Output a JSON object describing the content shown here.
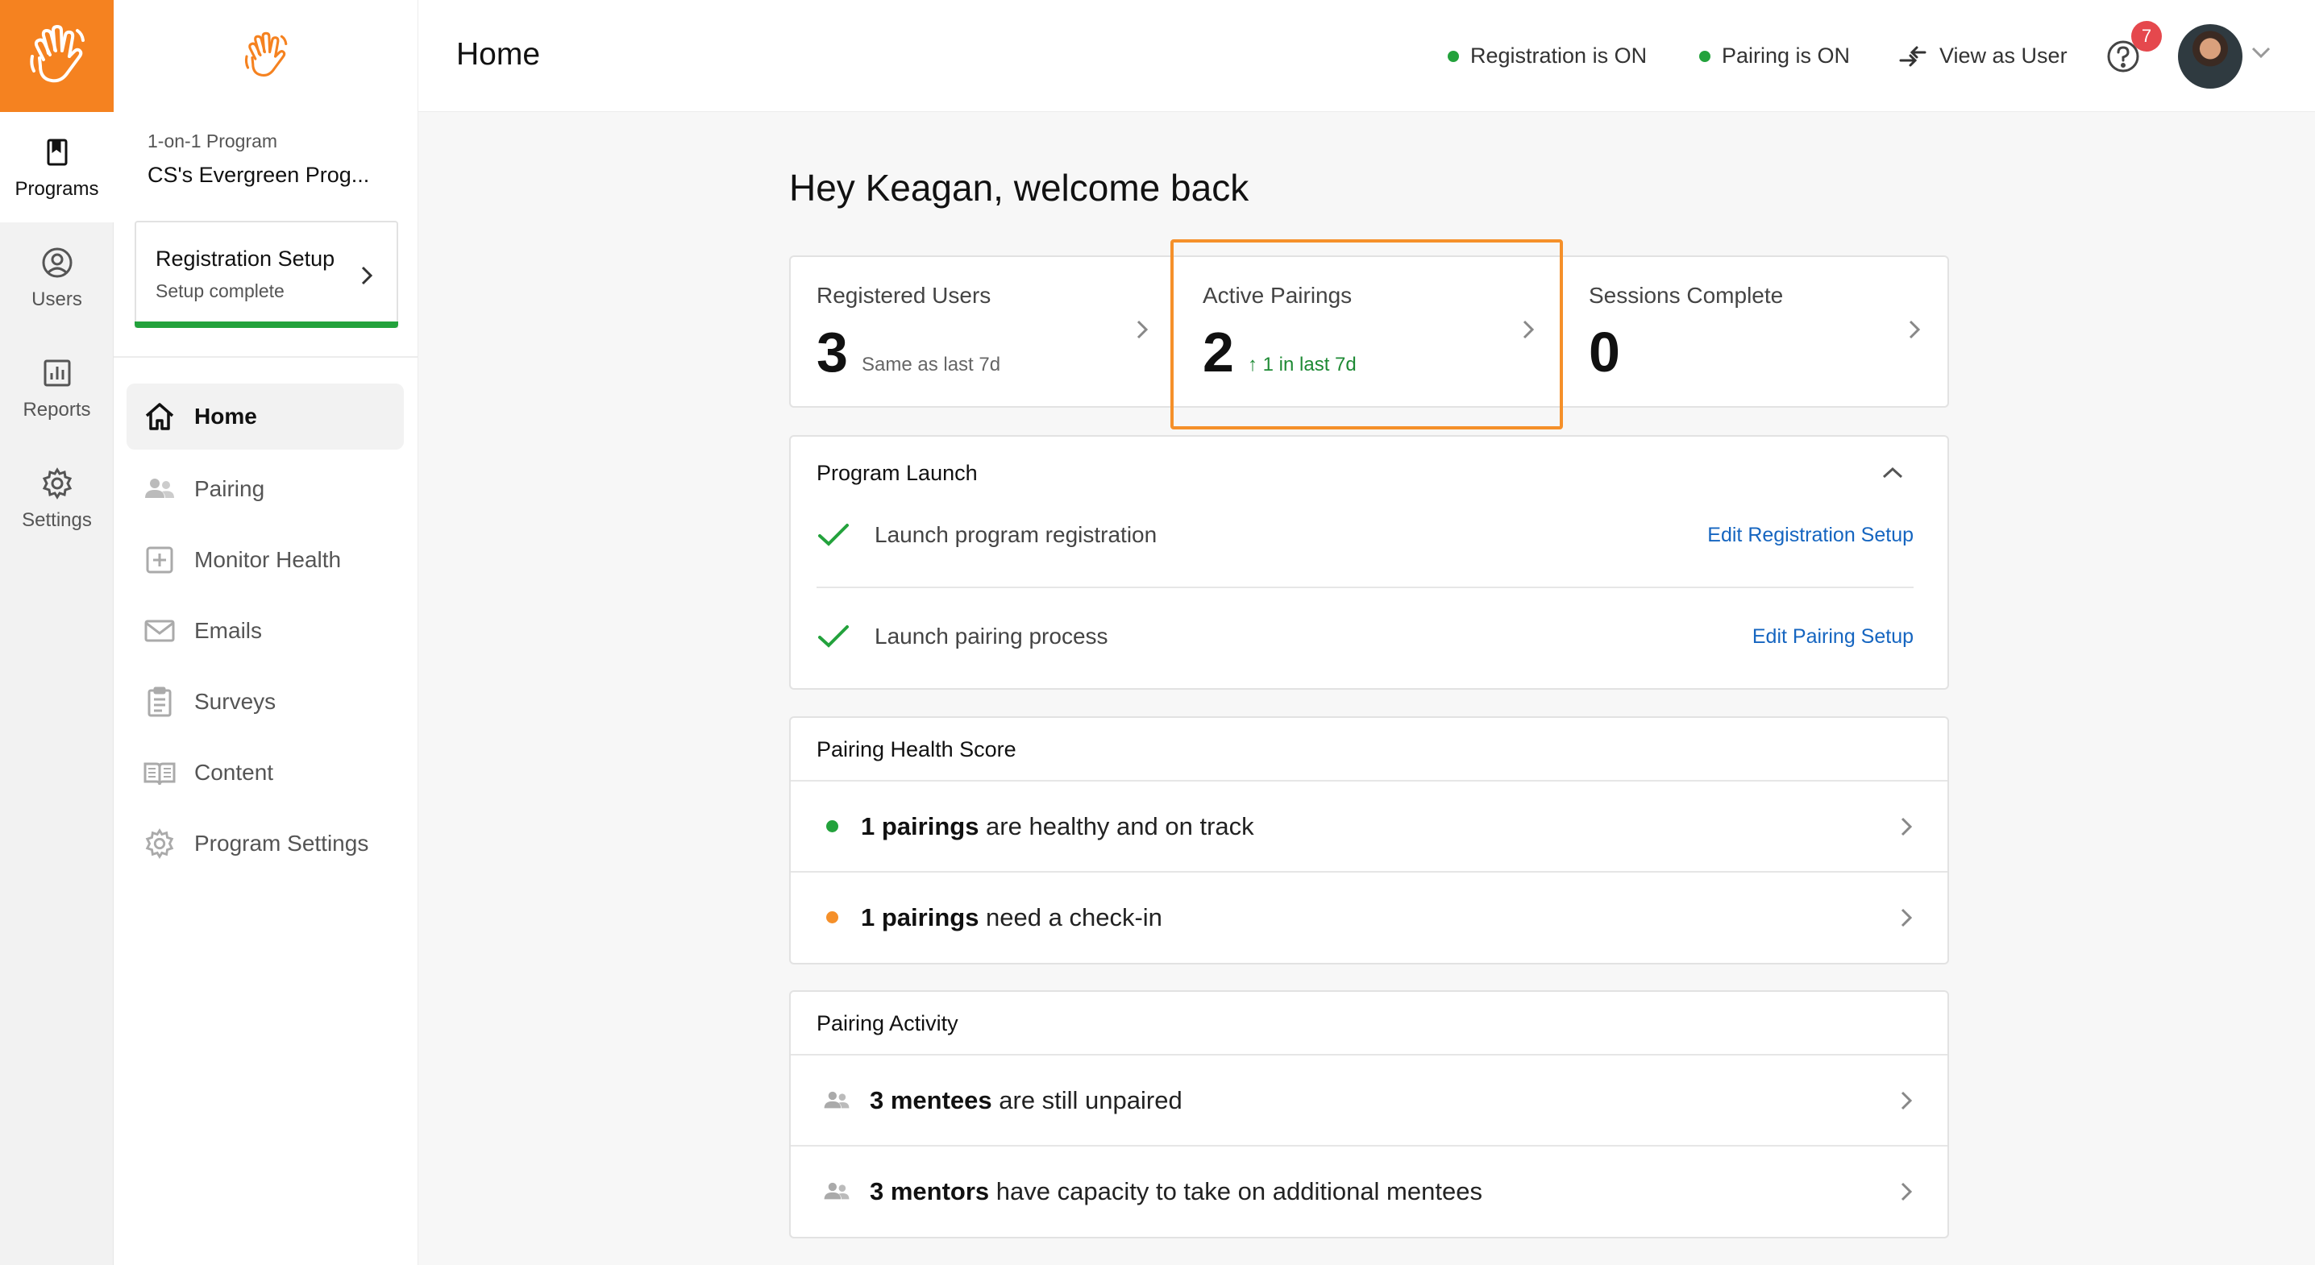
{
  "colors": {
    "brand": "#f58220",
    "green": "#23a23c",
    "orange": "#f5902a",
    "link": "#1565c0",
    "badge": "#e5484d"
  },
  "rail": {
    "items": [
      {
        "label": "Programs",
        "icon": "bookmark-icon",
        "active": true
      },
      {
        "label": "Users",
        "icon": "user-circle-icon"
      },
      {
        "label": "Reports",
        "icon": "bar-chart-icon"
      },
      {
        "label": "Settings",
        "icon": "gear-icon"
      }
    ]
  },
  "sidebar": {
    "program_type": "1-on-1 Program",
    "program_name": "CS's Evergreen Prog...",
    "registration_card": {
      "title": "Registration Setup",
      "subtitle": "Setup complete"
    },
    "nav": [
      {
        "label": "Home",
        "icon": "home-icon",
        "active": true
      },
      {
        "label": "Pairing",
        "icon": "people-icon"
      },
      {
        "label": "Monitor Health",
        "icon": "health-plus-icon"
      },
      {
        "label": "Emails",
        "icon": "envelope-icon"
      },
      {
        "label": "Surveys",
        "icon": "clipboard-icon"
      },
      {
        "label": "Content",
        "icon": "book-icon"
      },
      {
        "label": "Program Settings",
        "icon": "gear-icon"
      }
    ]
  },
  "header": {
    "title": "Home",
    "registration_status": "Registration is ON",
    "pairing_status": "Pairing is ON",
    "view_as_user": "View as User",
    "notification_count": "7"
  },
  "main": {
    "welcome": "Hey Keagan, welcome back",
    "stats": [
      {
        "label": "Registered Users",
        "value": "3",
        "note": "Same as last 7d"
      },
      {
        "label": "Active Pairings",
        "value": "2",
        "note": "↑ 1 in last 7d"
      },
      {
        "label": "Sessions Complete",
        "value": "0",
        "note": ""
      }
    ],
    "program_launch": {
      "title": "Program Launch",
      "steps": [
        {
          "label": "Launch program registration",
          "link": "Edit Registration Setup"
        },
        {
          "label": "Launch pairing process",
          "link": "Edit Pairing Setup"
        }
      ]
    },
    "health": {
      "title": "Pairing Health Score",
      "rows": [
        {
          "count": "1 pairings",
          "text": " are healthy and on track"
        },
        {
          "count": "1 pairings",
          "text": " need a check-in"
        }
      ]
    },
    "activity": {
      "title": "Pairing Activity",
      "rows": [
        {
          "count": "3 mentees",
          "text": " are still unpaired"
        },
        {
          "count": "3 mentors",
          "text": " have capacity to take on additional mentees"
        }
      ]
    }
  }
}
